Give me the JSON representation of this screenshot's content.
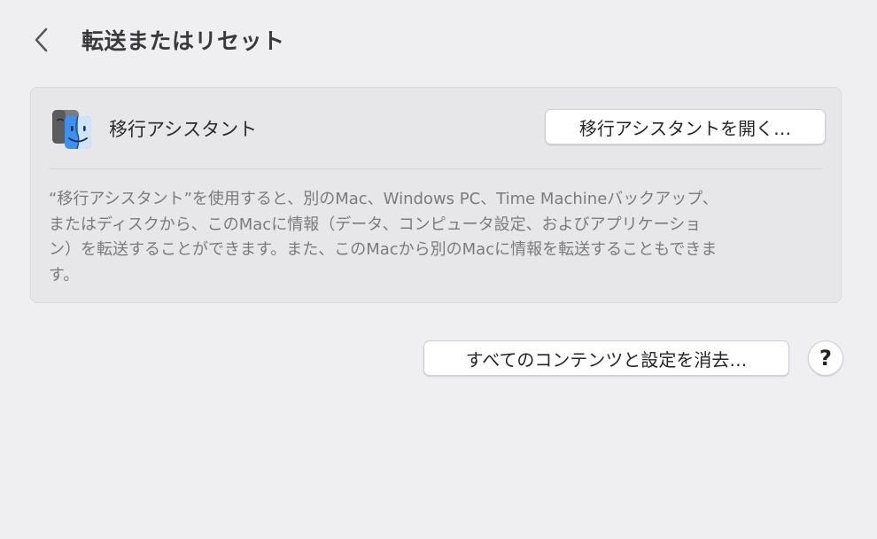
{
  "header": {
    "back_icon": "chevron-left-icon",
    "title": "転送またはリセット"
  },
  "migration": {
    "app_icon": "finder-migration-icon",
    "app_name": "移行アシスタント",
    "open_button_label": "移行アシスタントを開く…",
    "description_lines": [
      "“移行アシスタント”を使用すると、別のMac、Windows PC、Time Machineバックアップ、",
      "またはディスクから、このMacに情報（データ、コンピュータ設定、およびアプリケーショ",
      "ン）を転送することができます。また、このMacから別のMacに情報を転送することもできま",
      "す。"
    ]
  },
  "reset": {
    "erase_button_label": "すべてのコンテンツと設定を消去…",
    "help_label": "?"
  }
}
